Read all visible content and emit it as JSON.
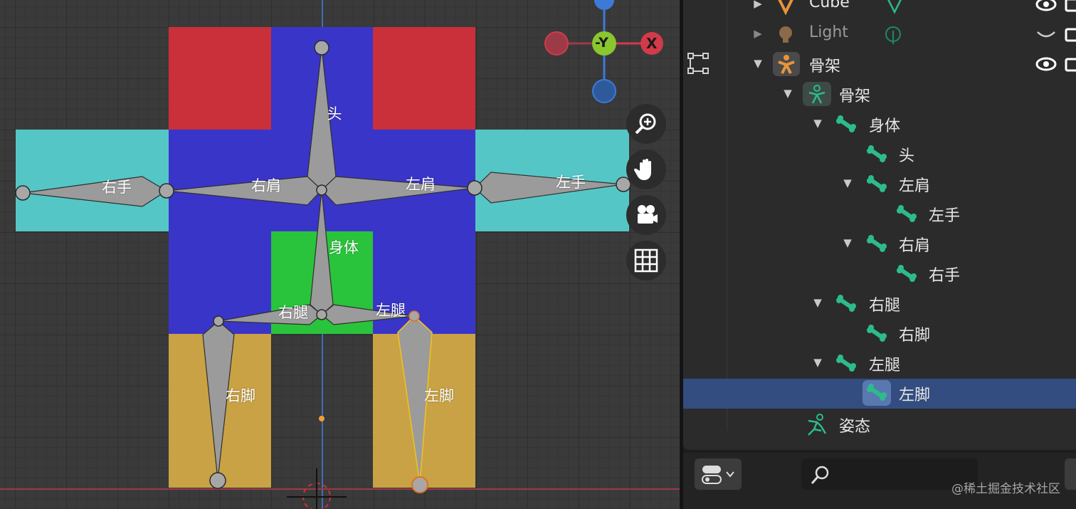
{
  "viewport": {
    "bones": [
      {
        "name": "头"
      },
      {
        "name": "右手"
      },
      {
        "name": "右肩"
      },
      {
        "name": "左肩"
      },
      {
        "name": "左手"
      },
      {
        "name": "身体"
      },
      {
        "name": "右腿"
      },
      {
        "name": "左腿"
      },
      {
        "name": "右脚"
      },
      {
        "name": "左脚"
      }
    ],
    "gizmo": {
      "x_label": "X",
      "y_label": "-Y"
    },
    "nav_buttons": [
      "zoom-icon",
      "hand-pan-icon",
      "camera-icon",
      "grid-icon"
    ],
    "colors": {
      "blue": "#3a35c9",
      "red": "#c9303a",
      "cyan": "#55c6c6",
      "green": "#29c43b",
      "yellow": "#c8a244",
      "bone": "#9a9a9a",
      "selected_bone_outline": "#f0c020"
    }
  },
  "outliner": {
    "rows": [
      {
        "label": "Cube",
        "icon": "mesh-icon"
      },
      {
        "label": "Light",
        "icon": "light-icon"
      },
      {
        "label": "骨架",
        "icon": "armature-icon"
      },
      {
        "label": "骨架",
        "icon": "armature-data-icon"
      },
      {
        "label": "身体",
        "icon": "bone-icon"
      },
      {
        "label": "头",
        "icon": "bone-icon"
      },
      {
        "label": "左肩",
        "icon": "bone-icon"
      },
      {
        "label": "左手",
        "icon": "bone-icon"
      },
      {
        "label": "右肩",
        "icon": "bone-icon"
      },
      {
        "label": "右手",
        "icon": "bone-icon"
      },
      {
        "label": "右腿",
        "icon": "bone-icon"
      },
      {
        "label": "右脚",
        "icon": "bone-icon"
      },
      {
        "label": "左腿",
        "icon": "bone-icon"
      },
      {
        "label": "左脚",
        "icon": "bone-icon",
        "selected": true
      },
      {
        "label": "姿态",
        "icon": "pose-icon"
      }
    ]
  },
  "properties": {
    "search_placeholder": ""
  },
  "watermark": "@稀土掘金技术社区"
}
